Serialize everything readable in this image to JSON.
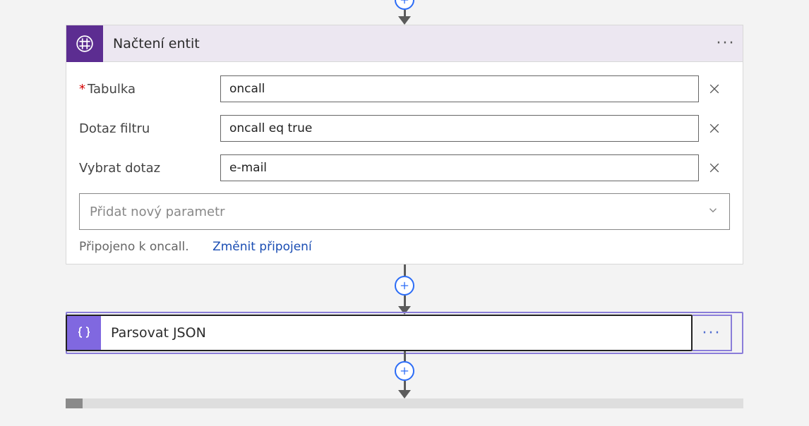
{
  "flow": {
    "step1": {
      "title": "Načtení entit",
      "params": {
        "table": {
          "label": "Tabulka",
          "value": "oncall",
          "required": true
        },
        "filter": {
          "label": "Dotaz filtru",
          "value": "oncall eq true",
          "required": false
        },
        "select": {
          "label": "Vybrat dotaz",
          "value": "e-mail",
          "required": false
        }
      },
      "addParamPlaceholder": "Přidat nový parametr",
      "connectionText": "Připojeno k oncall.",
      "changeConnection": "Změnit připojení"
    },
    "step2": {
      "title": "Parsovat JSON"
    }
  },
  "icons": {
    "entities": "entities-grid-icon",
    "json": "json-braces-icon",
    "plus": "plus-icon",
    "close": "close-icon",
    "dots": "more-dots-icon",
    "chevronDown": "chevron-down-icon"
  }
}
